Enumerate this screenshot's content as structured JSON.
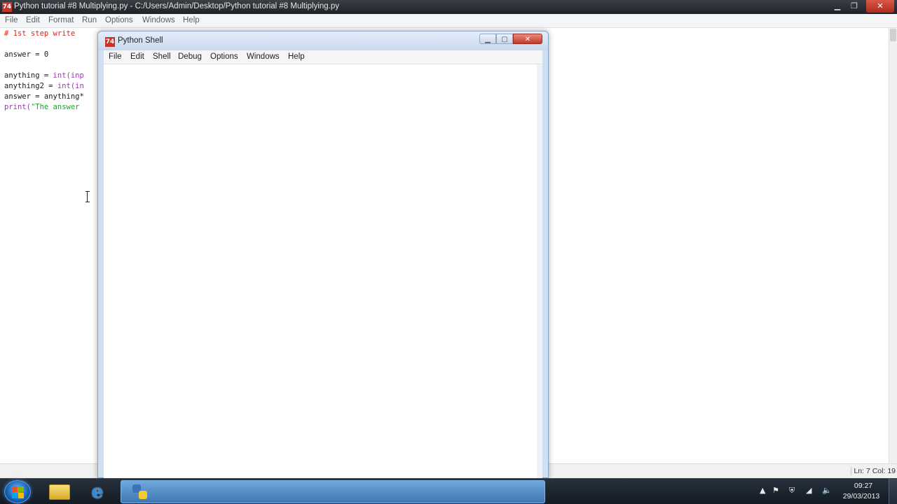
{
  "editor": {
    "title": "Python tutorial #8 Multiplying.py - C:/Users/Admin/Desktop/Python tutorial #8 Multiplying.py",
    "icon_label": "74",
    "menu": [
      "File",
      "Edit",
      "Format",
      "Run",
      "Options",
      "Windows",
      "Help"
    ],
    "code": {
      "line1": "# 1st step write",
      "line2_a": "answer = 0",
      "line3_a": "anything = ",
      "line3_b": "int(inp",
      "line4_a": "anything2 = ",
      "line4_b": "int(in",
      "line5_a": "answer = anything*",
      "line6_a": "print(",
      "line6_b": "\"The answer"
    },
    "status": "Ln: 7 Col: 19"
  },
  "shell": {
    "title": "Python Shell",
    "icon_label": "74",
    "menu": [
      "File",
      "Edit",
      "Shell",
      "Debug",
      "Options",
      "Windows",
      "Help"
    ]
  },
  "taskbar": {
    "clock_time": "09:27",
    "clock_date": "29/03/2013",
    "ie_glyph": "e"
  },
  "icons": {
    "start": "windows-start-orb-icon",
    "explorer": "folder-icon",
    "browser": "internet-explorer-icon",
    "python": "python-idle-icon"
  }
}
